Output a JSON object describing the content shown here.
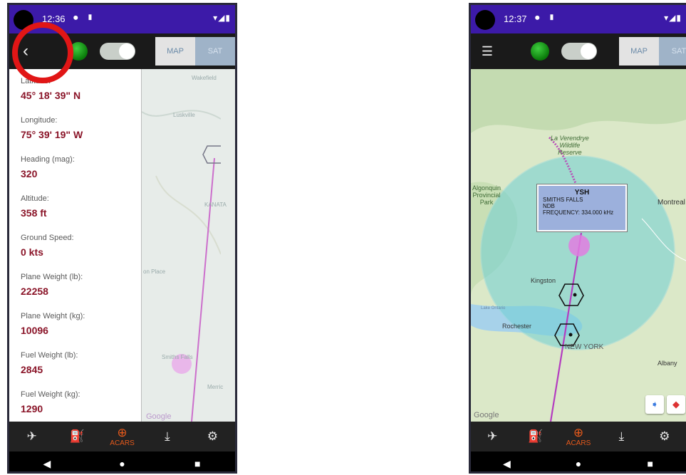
{
  "left_screen": {
    "status": {
      "time": "12:36",
      "icons": "⏺ ▮",
      "right": "▾◢▮"
    },
    "toolbar": {
      "back_icon": "‹",
      "map_label": "MAP",
      "sat_label": "SAT"
    },
    "fields": [
      {
        "label": "Latitude:",
        "value": "45° 18' 39\" N"
      },
      {
        "label": "Longitude:",
        "value": "75° 39' 19\" W"
      },
      {
        "label": "Heading (mag):",
        "value": "320"
      },
      {
        "label": "Altitude:",
        "value": "358 ft"
      },
      {
        "label": "Ground Speed:",
        "value": "0 kts"
      },
      {
        "label": "Plane Weight (lb):",
        "value": "22258"
      },
      {
        "label": "Plane Weight (kg):",
        "value": "10096"
      },
      {
        "label": "Fuel Weight (lb):",
        "value": "2845"
      },
      {
        "label": "Fuel Weight (kg):",
        "value": "1290"
      }
    ],
    "map_labels": {
      "wakefield": "Wakefield",
      "luskville": "Luskville",
      "kanata": "KANATA",
      "smiths_falls": "Smiths Falls",
      "merrick": "Merric",
      "place": "on Place",
      "google": "Google"
    }
  },
  "right_screen": {
    "status": {
      "time": "12:37",
      "icons": "⏺ ▮",
      "right": "▾◢▮"
    },
    "toolbar": {
      "menu_icon": "☰",
      "map_label": "MAP",
      "sat_label": "SAT"
    },
    "map_labels": {
      "reserve": "La Verendrye\nWildlife\nReserve",
      "algonquin": "Algonquin\nProvincial\nPark",
      "montreal": "Montreal",
      "kingston": "Kingston",
      "lake": "Lake Ontario",
      "rochester": "Rochester",
      "new_york": "NEW YORK",
      "albany": "Albany",
      "google": "Google"
    },
    "popup": {
      "code": "YSH",
      "name": "SMITHS FALLS",
      "type": "NDB",
      "frequency": "FREQUENCY: 334.000 kHz"
    }
  },
  "bottom_nav": [
    {
      "icon": "takeoff-icon",
      "glyph": "✈",
      "label": ""
    },
    {
      "icon": "fuel-icon",
      "glyph": "⛽",
      "label": ""
    },
    {
      "icon": "acars-icon",
      "glyph": "⊕",
      "label": "ACARS"
    },
    {
      "icon": "landing-icon",
      "glyph": "⤓",
      "label": ""
    },
    {
      "icon": "settings-icon",
      "glyph": "⚙",
      "label": ""
    }
  ],
  "system_nav": {
    "back": "◀",
    "home": "●",
    "recents": "■"
  },
  "colors": {
    "accent": "#e5591b",
    "value": "#8a1428",
    "statusbar": "#3c1aa8",
    "highlight": "#e11616"
  }
}
